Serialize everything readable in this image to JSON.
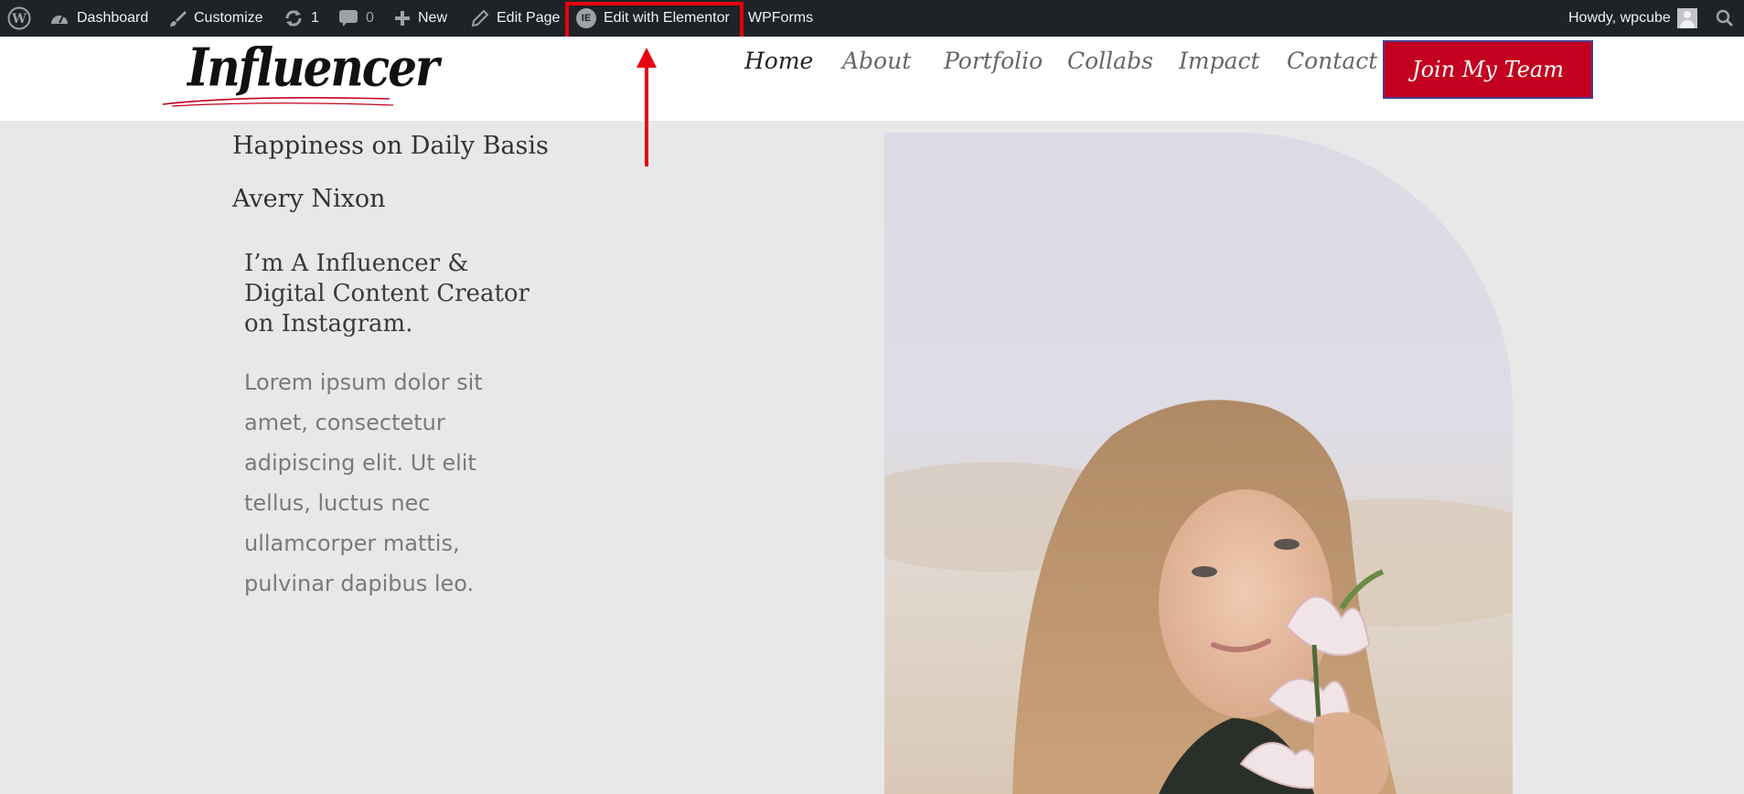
{
  "admin_bar": {
    "dashboard": "Dashboard",
    "customize": "Customize",
    "updates_count": "1",
    "comments_count": "0",
    "new": "New",
    "edit_page": "Edit Page",
    "edit_with_elementor": "Edit with Elementor",
    "wpforms": "WPForms",
    "greeting": "Howdy, wpcube"
  },
  "site": {
    "logo_text": "Influencer",
    "nav": [
      "Home",
      "About",
      "Portfolio",
      "Collabs",
      "Impact",
      "Contact"
    ],
    "cta": "Join My Team"
  },
  "hero": {
    "tagline": "Happiness on Daily Basis",
    "name": "Avery Nixon",
    "headline": "I’m A Influencer & Digital Content Creator on Instagram.",
    "bio": "Lorem ipsum dolor sit amet, consectetur adipiscing elit. Ut elit tellus, luctus nec ullamcorper mattis, pulvinar dapibus leo."
  },
  "colors": {
    "admin_bar_bg": "#1d2327",
    "highlight": "#e8000f",
    "cta_bg": "#c3001f",
    "page_bg": "#e9e8e9"
  }
}
